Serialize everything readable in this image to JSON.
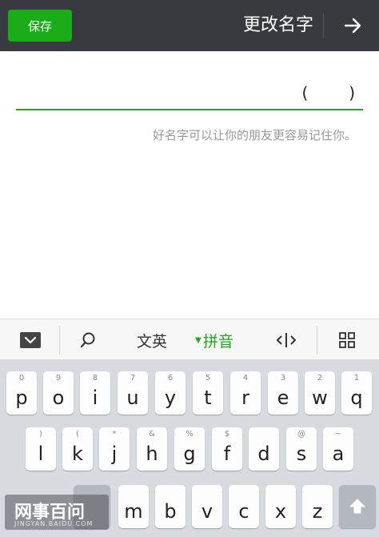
{
  "header": {
    "save_label": "保存",
    "title": "更改名字",
    "back_icon": "arrow-right-icon"
  },
  "name_field": {
    "value": "(        )"
  },
  "hint": "好名字可以让你的朋友更容易记住你。",
  "keyboard_toolbar": {
    "collapse_icon": "keyboard-collapse-icon",
    "search_icon": "search-icon",
    "wenying_label": "文英",
    "pinyin_label": "拼音",
    "cursor_icon": "cursor-move-icon",
    "grid_icon": "grid-icon"
  },
  "keys": {
    "row1": [
      {
        "main": "p",
        "sub": "0"
      },
      {
        "main": "o",
        "sub": "9"
      },
      {
        "main": "i",
        "sub": "8"
      },
      {
        "main": "u",
        "sub": "7"
      },
      {
        "main": "y",
        "sub": "6"
      },
      {
        "main": "t",
        "sub": "5"
      },
      {
        "main": "r",
        "sub": "4"
      },
      {
        "main": "e",
        "sub": "3"
      },
      {
        "main": "w",
        "sub": "2"
      },
      {
        "main": "q",
        "sub": "1"
      }
    ],
    "row2": [
      {
        "main": "l",
        "sub": ")"
      },
      {
        "main": "k",
        "sub": "("
      },
      {
        "main": "j",
        "sub": "*"
      },
      {
        "main": "h",
        "sub": "&"
      },
      {
        "main": "g",
        "sub": "%"
      },
      {
        "main": "f",
        "sub": "$"
      },
      {
        "main": "s",
        "sub": "@"
      },
      {
        "main": "a",
        "sub": "~"
      }
    ],
    "row3": [
      {
        "main": "m",
        "sub": ""
      },
      {
        "main": "b",
        "sub": ""
      },
      {
        "main": "v",
        "sub": ""
      },
      {
        "main": "c",
        "sub": ""
      },
      {
        "main": "x",
        "sub": ""
      },
      {
        "main": "z",
        "sub": ""
      }
    ],
    "shift_icon": "shift-arrow-icon"
  },
  "watermark": {
    "text": "网事百问",
    "sub": "JINGYAN.BAIDU.COM"
  },
  "colors": {
    "accent_green": "#1aad19",
    "header_bg": "#393a3f",
    "keyboard_bg": "#d7dadf"
  }
}
